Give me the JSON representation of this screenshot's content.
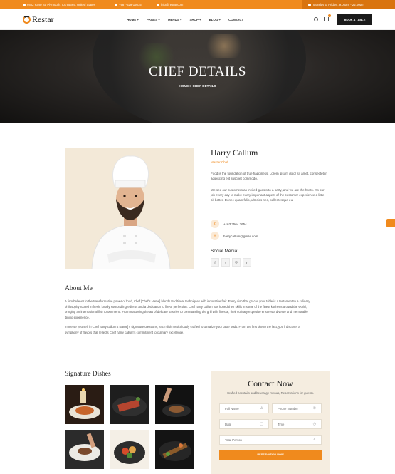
{
  "topbar": {
    "address": "9402 Rose St, Plymouth, CA 95669, United States",
    "phone": "+987-629-19815",
    "email": "info@restar.com",
    "hours": "Monday to Friday : 9.00am - 22.00pm"
  },
  "header": {
    "logo": "Restar",
    "nav": [
      "HOME +",
      "PAGES +",
      "MENUS +",
      "SHOP +",
      "BLOG +",
      "CONTACT"
    ],
    "book_button": "BOOK A TABLE"
  },
  "hero": {
    "title": "CHEF DETAILS",
    "breadcrumb_home": "HOME",
    "breadcrumb_sep": ">",
    "breadcrumb_current": "CHEF DETAILS"
  },
  "chef": {
    "name": "Harry Callum",
    "role": "Master Chef",
    "bio1": "Food is the foundation of true happiness. Lorem ipsum dolor sit amet, consectetur adipiscing elit suscpet commodo.",
    "bio2_lines": [
      "We see our customers as invited guests to a party, and we are the hosts. It's our",
      "job every day to make every important aspect of the customer experience a little",
      "bit better. Donec quam felis, ultricies nec, pellentesque eu."
    ],
    "phone": "+163 3564 3654",
    "email": "harrycallum@gmail.com",
    "social_title": "Social Media:",
    "social": [
      "f",
      "t",
      "◎",
      "in"
    ]
  },
  "about": {
    "title": "About Me",
    "p1_lines": [
      "A firm believer in the transformative power of food, Chef [Chef's Name] blends traditional techniques with innovative flair. Every dish that graces your table is a testament to a culinary",
      "philosophy rooted in fresh, locally sourced ingredients and a dedication to flavor perfection. Chef harry callum has honed their skills in some of the finest kitchens around the world,",
      "bringing an international flair to our menu. From mastering the art of delicate pastries to commanding the grill with finesse, their culinary expertise ensures a diverse and memorable",
      "dining experience."
    ],
    "p2_lines": [
      "Immerse yourself in Chef harry callum's Name]'s signature creations, each dish meticulously crafted to tantalize your taste buds. From the first bite to the last, you'll discover a",
      "symphony of flavors that reflects Chef harry callum's commitment to culinary excellence."
    ]
  },
  "dishes": {
    "title": "Signature Dishes"
  },
  "contact": {
    "title": "Contact Now",
    "subtitle": "Crafted cocktails and beverage menus, Reservations for guests.",
    "fields": {
      "full_name": "Full Name",
      "phone": "Phone Number",
      "date": "Date",
      "time": "Time",
      "total_person": "Total Person"
    },
    "button": "RESERVATION NOW"
  },
  "colors": {
    "accent": "#f08a1d",
    "dark": "#1b1b1b"
  }
}
